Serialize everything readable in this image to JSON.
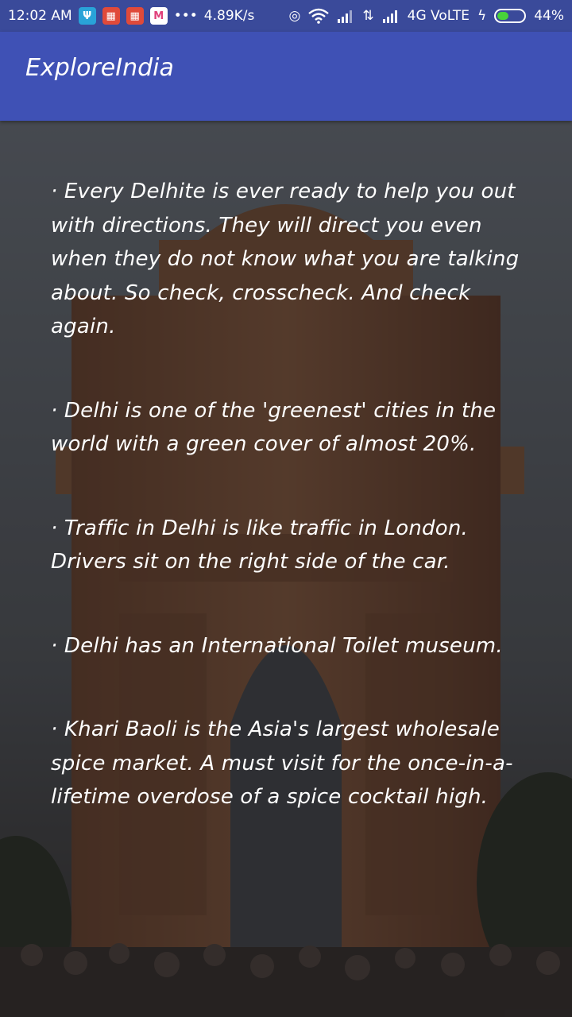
{
  "status_bar": {
    "time": "12:02 AM",
    "net_speed": "4.89K/s",
    "network_type": "4G VoLTE",
    "battery": "44%",
    "battery_level": 0.44,
    "icons": [
      "usb-icon",
      "calendar-icon",
      "calendar-icon",
      "myntra-icon",
      "more-icon",
      "hotspot-icon",
      "wifi-icon",
      "signal-icon",
      "data-icon",
      "signal-icon",
      "charging-icon",
      "battery-icon"
    ]
  },
  "app": {
    "title": "ExploreIndia",
    "bar_color": "#3f51b5"
  },
  "facts": [
    "· Every Delhite is ever ready to help you out with directions. They will direct you even when they do not know what you are talking about. So check, crosscheck. And check again.",
    "· Delhi is one of the 'greenest' cities in the world with a green cover of almost 20%.",
    "· Traffic in Delhi is like traffic in London.  Drivers sit on the right side of the car.",
    "· Delhi has an International Toilet museum.",
    "· Khari Baoli is the Asia's largest wholesale spice market. A must visit for the once-in-a-lifetime overdose of a spice cocktail high."
  ]
}
